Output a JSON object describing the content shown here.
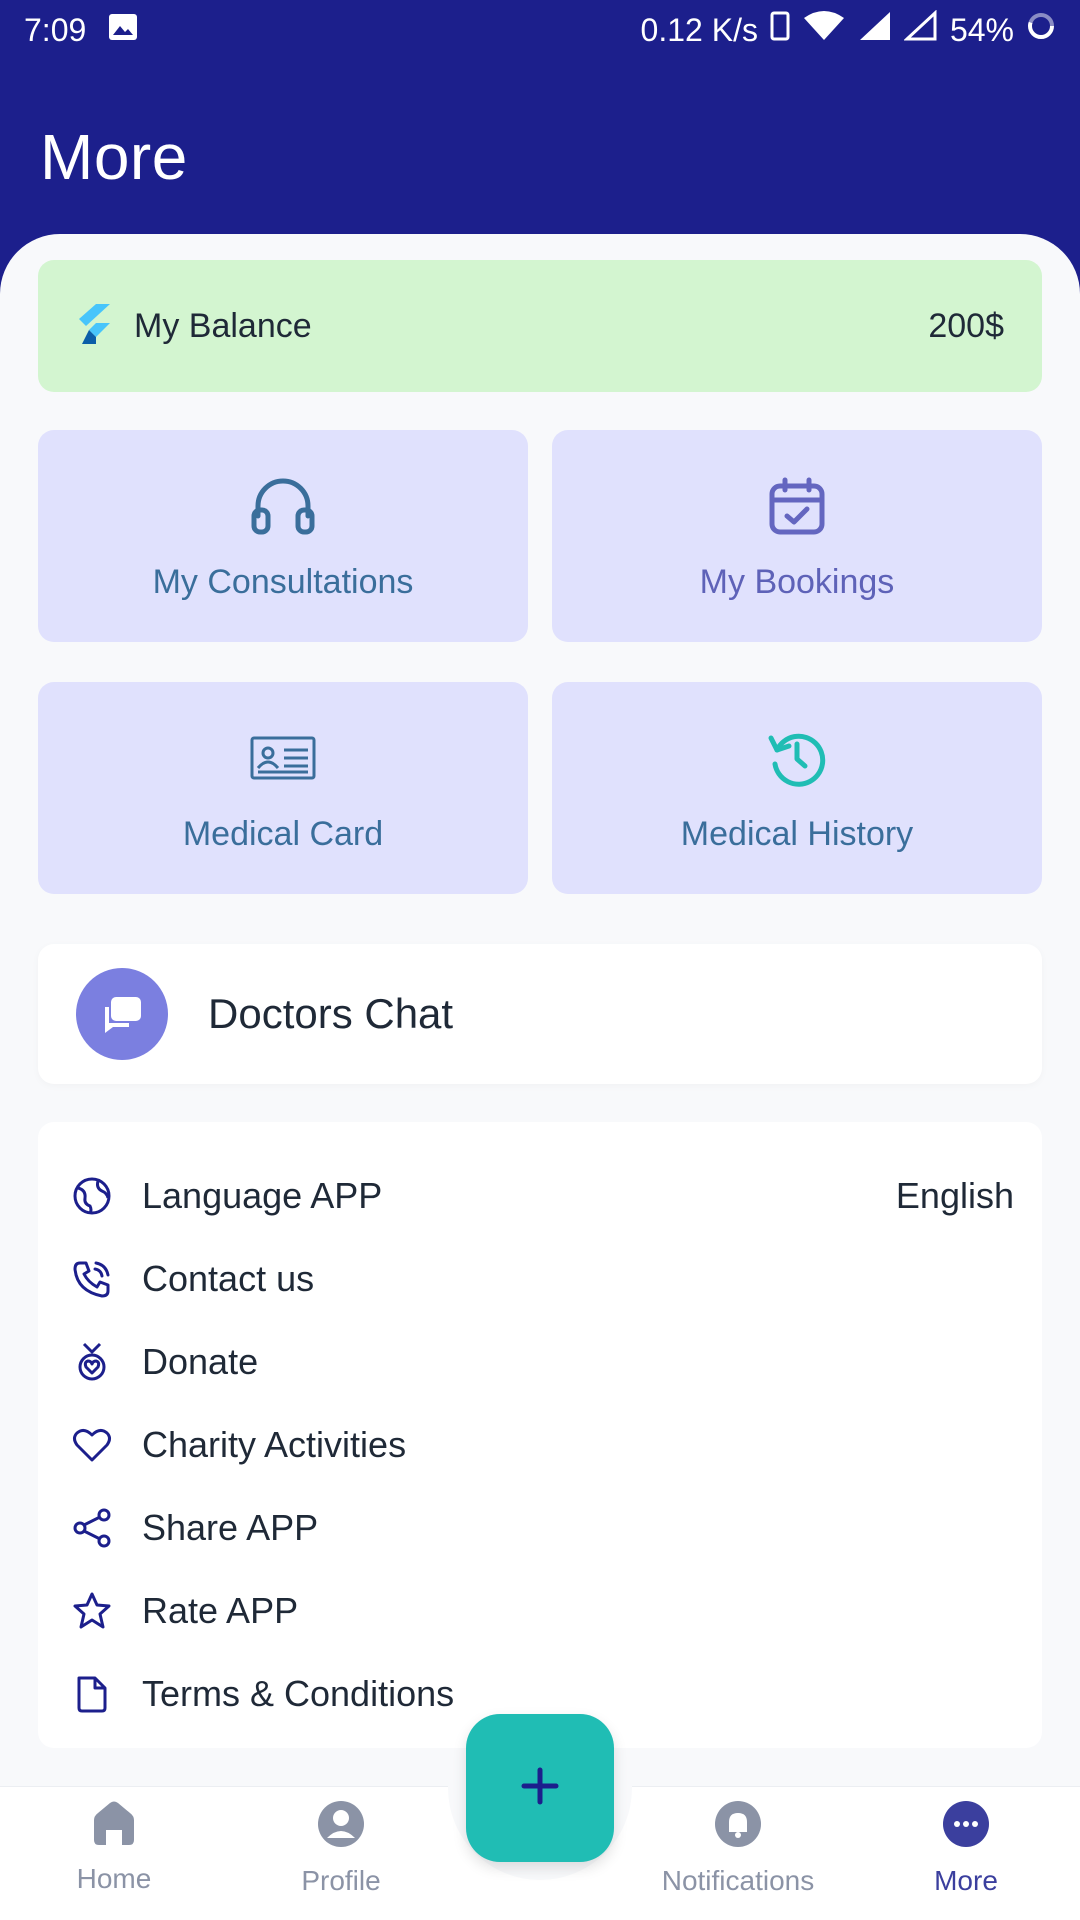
{
  "status_bar": {
    "time": "7:09",
    "speed": "0.12 K/s",
    "battery": "54%",
    "icons": [
      "image-icon",
      "phone-icon",
      "wifi-icon",
      "signal-icon",
      "battery-icon"
    ]
  },
  "header": {
    "title": "More"
  },
  "balance": {
    "label": "My Balance",
    "amount": "200$",
    "icon": "flutter-logo-icon"
  },
  "tiles": [
    {
      "label": "My Consultations",
      "icon": "headset-icon",
      "color": "#3a6e9b"
    },
    {
      "label": "My Bookings",
      "icon": "calendar-check-icon",
      "color": "#5e62b8"
    },
    {
      "label": "Medical Card",
      "icon": "id-card-icon",
      "color": "#3a6e9b"
    },
    {
      "label": "Medical History",
      "icon": "history-icon",
      "color": "#3a6e9b"
    }
  ],
  "doctors_chat": {
    "label": "Doctors Chat",
    "icon": "chat-bubbles-icon"
  },
  "settings": [
    {
      "label": "Language APP",
      "value": "English",
      "icon": "globe-icon"
    },
    {
      "label": "Contact us",
      "icon": "phone-call-icon"
    },
    {
      "label": "Donate",
      "icon": "medal-heart-icon"
    },
    {
      "label": "Charity Activities",
      "icon": "heart-icon"
    },
    {
      "label": "Share APP",
      "icon": "share-icon"
    },
    {
      "label": "Rate APP",
      "icon": "star-icon"
    },
    {
      "label": "Terms & Conditions",
      "icon": "document-icon"
    }
  ],
  "bottom_nav": {
    "items": [
      {
        "label": "Home",
        "icon": "home-icon"
      },
      {
        "label": "Profile",
        "icon": "profile-icon"
      },
      {
        "label": "Notifications",
        "icon": "bell-icon"
      },
      {
        "label": "More",
        "icon": "more-icon",
        "active": true
      }
    ],
    "fab": {
      "symbol": "+",
      "icon": "plus-icon"
    }
  },
  "colors": {
    "header_bg": "#1c1f8c",
    "balance_bg": "#d3f5d0",
    "tile_bg": "#e0e1fd",
    "fab_bg": "#20bdb4",
    "chat_avatar_bg": "#7b7fe0",
    "icon_dark": "#1c1f8c",
    "teal": "#20bdb4"
  }
}
